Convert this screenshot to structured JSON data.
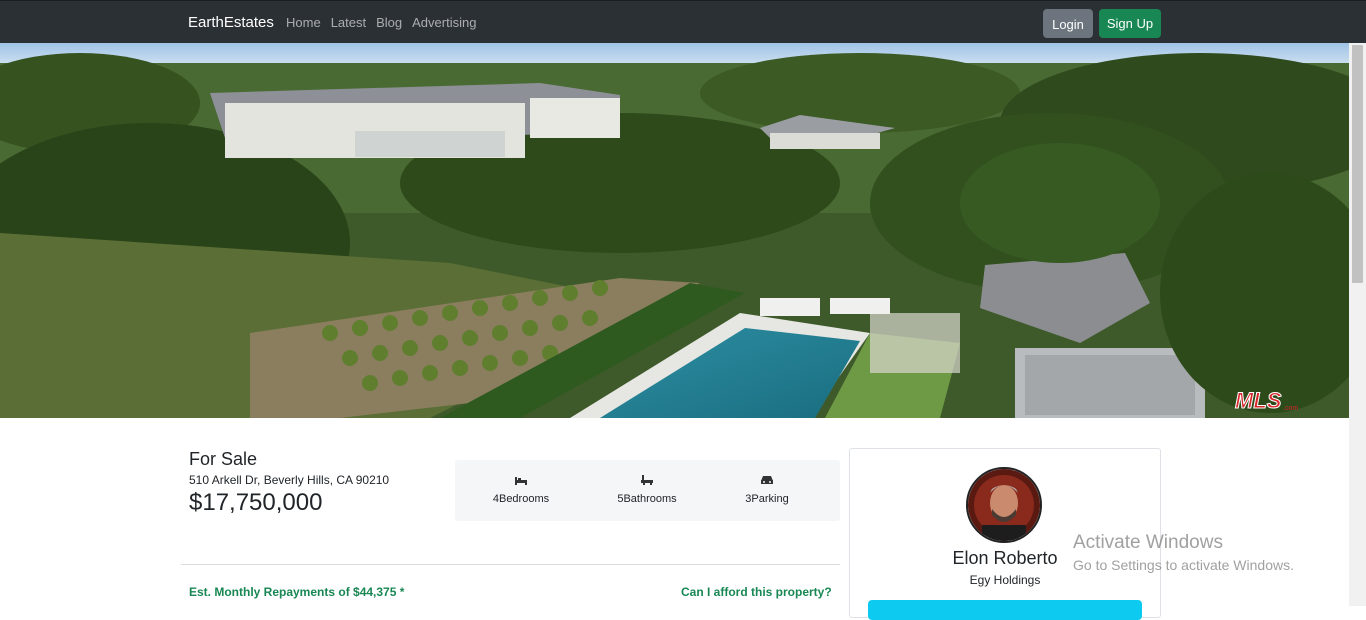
{
  "nav": {
    "brand": "EarthEstates",
    "links": [
      "Home",
      "Latest",
      "Blog",
      "Advertising"
    ],
    "login_label": "Login",
    "signup_label": "Sign Up"
  },
  "hero": {
    "image": "aerial-mansion-photo",
    "logo_text": "THE MLS.com"
  },
  "listing": {
    "status": "For Sale",
    "address": "510 Arkell Dr, Beverly Hills, CA 90210",
    "price": "$17,750,000",
    "features": [
      {
        "icon": "bed-icon",
        "label": "4Bedrooms"
      },
      {
        "icon": "bath-icon",
        "label": "5Bathrooms"
      },
      {
        "icon": "car-icon",
        "label": "3Parking"
      }
    ],
    "repayments": "Est. Monthly Repayments of $44,375 *",
    "afford_link": "Can I afford this property?"
  },
  "agent": {
    "name": "Elon Roberto",
    "company": "Egy Holdings"
  },
  "watermark": {
    "line1": "Activate Windows",
    "line2": "Go to Settings to activate Windows."
  },
  "colors": {
    "navbar": "#2b3035",
    "success": "#198754",
    "secondary": "#6c757d",
    "info": "#0dcaf0"
  }
}
